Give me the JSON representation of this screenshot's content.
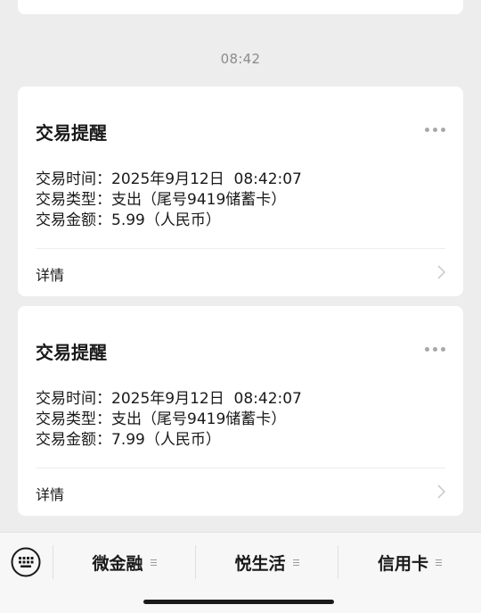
{
  "chat": {
    "timestamp": "08:42",
    "messages": [
      {
        "title": "交易提醒",
        "time_label": "交易时间：",
        "time_value": "2025年9月12日  08:42:07",
        "type_label": "交易类型：",
        "type_value": "支出（尾号9419储蓄卡）",
        "amount_label": "交易金额：",
        "amount_value": "5.99（人民币）",
        "detail_label": "详情"
      },
      {
        "title": "交易提醒",
        "time_label": "交易时间：",
        "time_value": "2025年9月12日  08:42:07",
        "type_label": "交易类型：",
        "type_value": "支出（尾号9419储蓄卡）",
        "amount_label": "交易金额：",
        "amount_value": "7.99（人民币）",
        "detail_label": "详情"
      }
    ]
  },
  "menu": {
    "keyboard_icon": "keyboard-icon",
    "items": [
      {
        "label": "微金融"
      },
      {
        "label": "悦生活"
      },
      {
        "label": "信用卡"
      }
    ]
  },
  "colors": {
    "background": "#ededed",
    "card": "#ffffff",
    "text": "#191919",
    "muted": "#8c8c8c"
  }
}
